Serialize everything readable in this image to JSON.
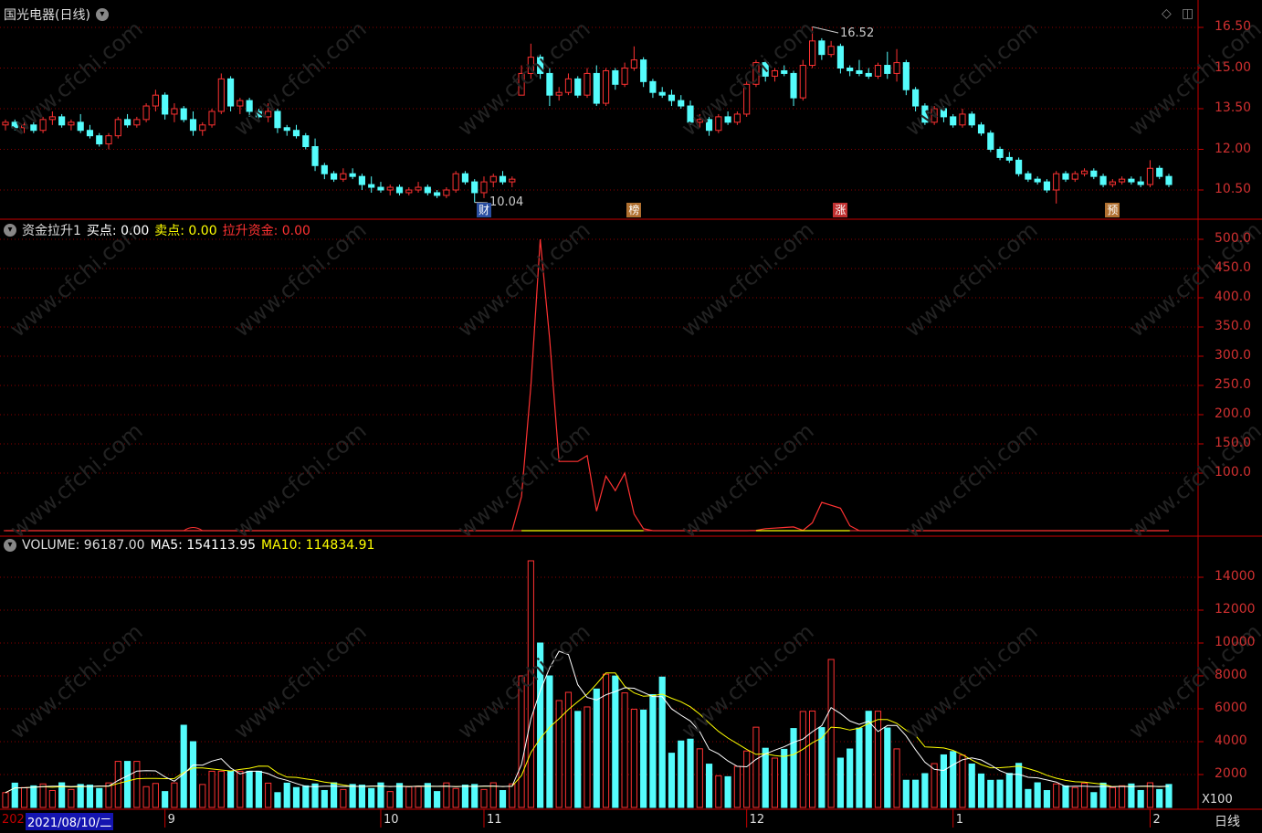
{
  "header": {
    "title": "国光电器(日线)",
    "menu_icon": "chevron-down-icon",
    "restore_icon": "diamond-icon",
    "window_icon": "window-icon"
  },
  "price_pane": {
    "yticks": [
      "16.50",
      "15.00",
      "13.50",
      "12.00",
      "10.50"
    ],
    "low_label": "10.04",
    "high_label": "16.52",
    "markers": [
      {
        "text": "财",
        "color": "#2a4ea0"
      },
      {
        "text": "榜",
        "color": "#b07030"
      },
      {
        "text": "涨",
        "color": "#c03030"
      },
      {
        "text": "预",
        "color": "#b07030"
      }
    ],
    "candles": [
      [
        12.9,
        13.1,
        12.7,
        13.0
      ],
      [
        13.0,
        13.1,
        12.7,
        12.8
      ],
      [
        12.8,
        13.0,
        12.6,
        12.9
      ],
      [
        12.9,
        13.0,
        12.6,
        12.7
      ],
      [
        12.7,
        13.2,
        12.6,
        13.1
      ],
      [
        13.1,
        13.4,
        12.9,
        13.2
      ],
      [
        13.2,
        13.3,
        12.8,
        12.9
      ],
      [
        12.9,
        13.1,
        12.7,
        13.0
      ],
      [
        13.0,
        13.3,
        12.6,
        12.7
      ],
      [
        12.7,
        12.9,
        12.4,
        12.5
      ],
      [
        12.5,
        12.6,
        12.1,
        12.2
      ],
      [
        12.2,
        12.6,
        12.0,
        12.5
      ],
      [
        12.5,
        13.2,
        12.4,
        13.1
      ],
      [
        13.1,
        13.3,
        12.8,
        12.9
      ],
      [
        12.9,
        13.2,
        12.8,
        13.1
      ],
      [
        13.1,
        13.7,
        13.0,
        13.6
      ],
      [
        13.6,
        14.2,
        13.4,
        14.0
      ],
      [
        14.0,
        14.1,
        13.1,
        13.3
      ],
      [
        13.3,
        13.7,
        13.0,
        13.5
      ],
      [
        13.5,
        13.6,
        13.0,
        13.1
      ],
      [
        13.1,
        13.4,
        12.5,
        12.7
      ],
      [
        12.7,
        13.0,
        12.5,
        12.9
      ],
      [
        12.9,
        13.5,
        12.8,
        13.4
      ],
      [
        13.4,
        14.8,
        13.3,
        14.6
      ],
      [
        14.6,
        14.7,
        13.4,
        13.6
      ],
      [
        13.6,
        13.9,
        13.3,
        13.8
      ],
      [
        13.8,
        13.9,
        13.2,
        13.4
      ],
      [
        13.4,
        13.5,
        13.1,
        13.2
      ],
      [
        13.2,
        13.7,
        13.0,
        13.4
      ],
      [
        13.4,
        13.5,
        12.6,
        12.8
      ],
      [
        12.8,
        12.9,
        12.5,
        12.7
      ],
      [
        12.7,
        12.9,
        12.4,
        12.5
      ],
      [
        12.5,
        12.6,
        12.0,
        12.1
      ],
      [
        12.1,
        12.4,
        11.2,
        11.4
      ],
      [
        11.4,
        11.5,
        10.9,
        11.1
      ],
      [
        11.1,
        11.2,
        10.8,
        10.9
      ],
      [
        10.9,
        11.3,
        10.8,
        11.1
      ],
      [
        11.1,
        11.3,
        10.9,
        11.0
      ],
      [
        11.0,
        11.1,
        10.5,
        10.7
      ],
      [
        10.7,
        11.0,
        10.4,
        10.6
      ],
      [
        10.6,
        10.8,
        10.4,
        10.5
      ],
      [
        10.5,
        10.7,
        10.3,
        10.6
      ],
      [
        10.6,
        10.7,
        10.3,
        10.4
      ],
      [
        10.4,
        10.6,
        10.3,
        10.5
      ],
      [
        10.5,
        10.8,
        10.4,
        10.6
      ],
      [
        10.6,
        10.7,
        10.3,
        10.4
      ],
      [
        10.4,
        10.5,
        10.2,
        10.3
      ],
      [
        10.3,
        10.6,
        10.2,
        10.5
      ],
      [
        10.5,
        11.2,
        10.4,
        11.1
      ],
      [
        11.1,
        11.2,
        10.7,
        10.8
      ],
      [
        10.8,
        10.9,
        10.04,
        10.4
      ],
      [
        10.4,
        11.0,
        10.2,
        10.8
      ],
      [
        10.8,
        11.1,
        10.6,
        11.0
      ],
      [
        11.0,
        11.2,
        10.7,
        10.8
      ],
      [
        10.8,
        11.0,
        10.6,
        10.9
      ],
      [
        14.0,
        15.1,
        14.0,
        14.8
      ],
      [
        14.8,
        15.9,
        14.6,
        15.4
      ],
      [
        15.4,
        15.5,
        14.6,
        14.8
      ],
      [
        14.8,
        15.0,
        13.6,
        14.0
      ],
      [
        14.0,
        14.3,
        13.8,
        14.1
      ],
      [
        14.1,
        14.8,
        14.0,
        14.6
      ],
      [
        14.6,
        14.7,
        13.9,
        14.0
      ],
      [
        14.0,
        15.0,
        13.9,
        14.8
      ],
      [
        14.8,
        15.1,
        13.6,
        13.7
      ],
      [
        13.7,
        15.0,
        13.6,
        14.9
      ],
      [
        14.9,
        15.0,
        14.2,
        14.4
      ],
      [
        14.4,
        15.2,
        14.3,
        15.0
      ],
      [
        15.0,
        15.8,
        14.9,
        15.3
      ],
      [
        15.3,
        15.4,
        14.3,
        14.5
      ],
      [
        14.5,
        14.6,
        13.9,
        14.1
      ],
      [
        14.1,
        14.3,
        13.9,
        14.0
      ],
      [
        14.0,
        14.2,
        13.6,
        13.8
      ],
      [
        13.8,
        14.0,
        13.5,
        13.6
      ],
      [
        13.6,
        13.8,
        12.9,
        13.0
      ],
      [
        13.0,
        13.3,
        12.8,
        13.1
      ],
      [
        13.1,
        13.2,
        12.5,
        12.7
      ],
      [
        12.7,
        13.3,
        12.6,
        13.2
      ],
      [
        13.2,
        13.4,
        12.9,
        13.0
      ],
      [
        13.0,
        13.4,
        12.9,
        13.3
      ],
      [
        13.3,
        14.5,
        13.2,
        14.4
      ],
      [
        14.4,
        15.3,
        14.3,
        15.2
      ],
      [
        15.2,
        15.3,
        14.5,
        14.7
      ],
      [
        14.7,
        15.0,
        14.5,
        14.9
      ],
      [
        14.9,
        15.1,
        14.7,
        14.8
      ],
      [
        14.8,
        14.9,
        13.6,
        13.9
      ],
      [
        13.9,
        15.3,
        13.8,
        15.1
      ],
      [
        15.1,
        16.52,
        15.0,
        16.0
      ],
      [
        16.0,
        16.1,
        15.3,
        15.5
      ],
      [
        15.5,
        16.0,
        15.4,
        15.8
      ],
      [
        15.8,
        15.9,
        14.8,
        15.0
      ],
      [
        15.0,
        15.1,
        14.7,
        14.9
      ],
      [
        14.9,
        15.3,
        14.7,
        14.8
      ],
      [
        14.8,
        15.0,
        14.6,
        14.7
      ],
      [
        14.7,
        15.2,
        14.6,
        15.1
      ],
      [
        15.1,
        15.6,
        14.6,
        14.8
      ],
      [
        14.8,
        15.7,
        14.5,
        15.2
      ],
      [
        15.2,
        15.3,
        14.0,
        14.2
      ],
      [
        14.2,
        14.3,
        13.4,
        13.6
      ],
      [
        13.6,
        13.7,
        12.9,
        13.0
      ],
      [
        13.0,
        13.6,
        12.9,
        13.5
      ],
      [
        13.5,
        13.6,
        13.0,
        13.2
      ],
      [
        13.2,
        13.3,
        12.8,
        12.9
      ],
      [
        12.9,
        13.5,
        12.8,
        13.3
      ],
      [
        13.3,
        13.4,
        12.8,
        12.9
      ],
      [
        12.9,
        13.0,
        12.5,
        12.6
      ],
      [
        12.6,
        12.7,
        11.9,
        12.0
      ],
      [
        12.0,
        12.1,
        11.6,
        11.7
      ],
      [
        11.7,
        11.9,
        11.5,
        11.6
      ],
      [
        11.6,
        11.7,
        11.0,
        11.1
      ],
      [
        11.1,
        11.2,
        10.8,
        10.9
      ],
      [
        10.9,
        11.0,
        10.7,
        10.8
      ],
      [
        10.8,
        10.9,
        10.4,
        10.5
      ],
      [
        10.5,
        11.2,
        10.0,
        11.1
      ],
      [
        11.1,
        11.2,
        10.8,
        10.9
      ],
      [
        10.9,
        11.2,
        10.8,
        11.1
      ],
      [
        11.1,
        11.3,
        11.0,
        11.2
      ],
      [
        11.2,
        11.3,
        10.9,
        11.0
      ],
      [
        11.0,
        11.1,
        10.6,
        10.7
      ],
      [
        10.7,
        10.9,
        10.6,
        10.8
      ],
      [
        10.8,
        11.0,
        10.7,
        10.9
      ],
      [
        10.9,
        11.0,
        10.7,
        10.8
      ],
      [
        10.8,
        11.0,
        10.6,
        10.7
      ],
      [
        10.7,
        11.6,
        10.6,
        11.3
      ],
      [
        11.3,
        11.4,
        10.9,
        11.0
      ],
      [
        11.0,
        11.1,
        10.6,
        10.7
      ]
    ]
  },
  "funds_pane": {
    "title": "资金拉升1",
    "buy_label": "买点: 0.00",
    "sell_label": "卖点: 0.00",
    "lift_label": "拉升资金: 0.00",
    "yticks": [
      "500.0",
      "450.0",
      "400.0",
      "350.0",
      "300.0",
      "250.0",
      "200.0",
      "150.0",
      "100.0"
    ]
  },
  "volume_pane": {
    "volume_label": "VOLUME: 96187.00",
    "ma5_label": "MA5: 154113.95",
    "ma10_label": "MA10: 114834.91",
    "yticks": [
      "14000",
      "12000",
      "10000",
      "8000",
      "6000",
      "4000",
      "2000"
    ],
    "unit_label": "X100",
    "period_label": "日线"
  },
  "xaxis": {
    "cursor_date": "2021/08/10/二",
    "year_prefix": "202",
    "month_labels": [
      "9",
      "10",
      "11",
      "12",
      "1",
      "2"
    ]
  },
  "watermark": "www.cfchi.com",
  "colors": {
    "up": "#ff3232",
    "down": "#54fcfc",
    "axis": "#c80000",
    "grid": "#8c0000",
    "ma5": "#ffffff",
    "ma10": "#ffff00"
  }
}
